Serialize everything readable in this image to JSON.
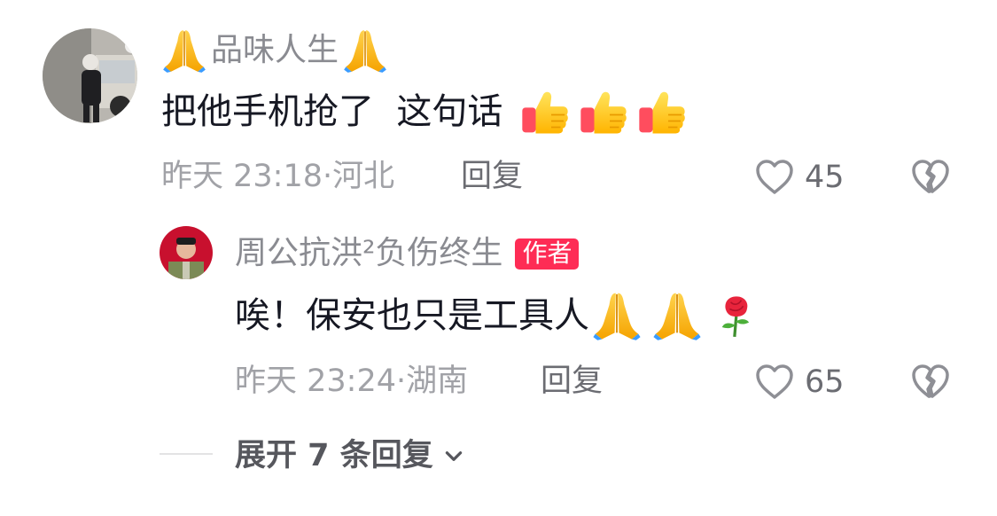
{
  "comment": {
    "username": "品味人生",
    "text": "把他手机抢了  这句话",
    "time": "昨天 23:18",
    "location": "河北",
    "reply_label": "回复",
    "likes": "45",
    "icons": {
      "name_prefix": "folded-hands-icon",
      "name_suffix": "folded-hands-icon",
      "text_emojis": [
        "thumbs-up-icon",
        "thumbs-up-icon",
        "thumbs-up-icon"
      ]
    }
  },
  "reply": {
    "username": "周公抗洪²负伤终生",
    "badge": "作者",
    "text": "唉！保安也只是工具人",
    "time": "昨天 23:24",
    "location": "湖南",
    "reply_label": "回复",
    "likes": "65",
    "icons": {
      "text_emojis": [
        "folded-hands-icon",
        "folded-hands-icon",
        "rose-icon"
      ]
    }
  },
  "expand": {
    "label": "展开 7 条回复"
  },
  "colors": {
    "author_badge": "#fe2c55",
    "muted_text": "#a1a2a7",
    "username": "#8a8b91",
    "body_text": "#161823"
  }
}
